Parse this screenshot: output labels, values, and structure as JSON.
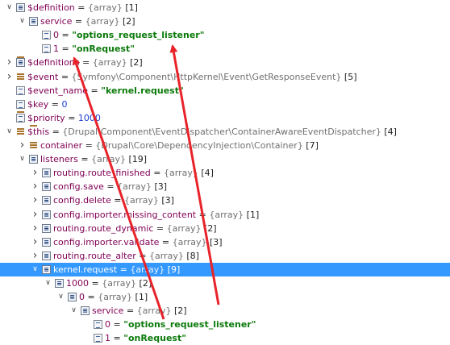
{
  "tree": [
    {
      "depth": 0,
      "expand": "open",
      "icon": "array",
      "name": "$definition",
      "eq": " = ",
      "type": "{array}",
      "suffix": " [1]"
    },
    {
      "depth": 1,
      "expand": "open",
      "icon": "array",
      "name": "service",
      "eq": " = ",
      "type": "{array}",
      "suffix": " [2]"
    },
    {
      "depth": 2,
      "expand": "none",
      "icon": "leaf",
      "name": "0",
      "eq": " = ",
      "value": "\"options_request_listener\"",
      "valueKind": "string"
    },
    {
      "depth": 2,
      "expand": "none",
      "icon": "leaf",
      "name": "1",
      "eq": " = ",
      "value": "\"onRequest\"",
      "valueKind": "string"
    },
    {
      "depth": 0,
      "expand": "closed",
      "icon": "array",
      "name": "$definitions",
      "eq": " = ",
      "type": "{array}",
      "suffix": " [2]"
    },
    {
      "depth": 0,
      "expand": "closed",
      "icon": "object",
      "name": "$event",
      "eq": " = ",
      "type": "{Symfony\\Component\\HttpKernel\\Event\\GetResponseEvent}",
      "suffix": " [5]"
    },
    {
      "depth": 0,
      "expand": "none",
      "icon": "leaf",
      "name": "$event_name",
      "eq": " = ",
      "value": "\"kernel.request\"",
      "valueKind": "string"
    },
    {
      "depth": 0,
      "expand": "none",
      "icon": "leaf",
      "name": "$key",
      "eq": " = ",
      "value": "0",
      "valueKind": "number"
    },
    {
      "depth": 0,
      "expand": "none",
      "icon": "leaf",
      "name": "$priority",
      "eq": " = ",
      "value": "1000",
      "valueKind": "number"
    },
    {
      "depth": 0,
      "expand": "open",
      "icon": "object",
      "name": "$this",
      "eq": " = ",
      "type": "{Drupal\\Component\\EventDispatcher\\ContainerAwareEventDispatcher}",
      "suffix": " [4]"
    },
    {
      "depth": 1,
      "expand": "closed",
      "icon": "object",
      "name": "container",
      "eq": " = ",
      "type": "{Drupal\\Core\\DependencyInjection\\Container}",
      "suffix": " [7]"
    },
    {
      "depth": 1,
      "expand": "open",
      "icon": "array",
      "name": "listeners",
      "eq": " = ",
      "type": "{array}",
      "suffix": " [19]"
    },
    {
      "depth": 2,
      "expand": "closed",
      "icon": "array",
      "name": "routing.route_finished",
      "eq": " = ",
      "type": "{array}",
      "suffix": " [4]"
    },
    {
      "depth": 2,
      "expand": "closed",
      "icon": "array",
      "name": "config.save",
      "eq": " = ",
      "type": "{array}",
      "suffix": " [3]"
    },
    {
      "depth": 2,
      "expand": "closed",
      "icon": "array",
      "name": "config.delete",
      "eq": " = ",
      "type": "{array}",
      "suffix": " [3]"
    },
    {
      "depth": 2,
      "expand": "closed",
      "icon": "array",
      "name": "config.importer.missing_content",
      "eq": " = ",
      "type": "{array}",
      "suffix": " [1]"
    },
    {
      "depth": 2,
      "expand": "closed",
      "icon": "array",
      "name": "routing.route_dynamic",
      "eq": " = ",
      "type": "{array}",
      "suffix": " [2]"
    },
    {
      "depth": 2,
      "expand": "closed",
      "icon": "array",
      "name": "config.importer.validate",
      "eq": " = ",
      "type": "{array}",
      "suffix": " [3]"
    },
    {
      "depth": 2,
      "expand": "closed",
      "icon": "array",
      "name": "routing.route_alter",
      "eq": " = ",
      "type": "{array}",
      "suffix": " [8]"
    },
    {
      "depth": 2,
      "expand": "open",
      "icon": "array",
      "name": "kernel.request",
      "eq": " = ",
      "type": "{array}",
      "suffix": " [9]",
      "selected": true
    },
    {
      "depth": 3,
      "expand": "open",
      "icon": "array",
      "name": "1000",
      "eq": " = ",
      "type": "{array}",
      "suffix": " [2]"
    },
    {
      "depth": 4,
      "expand": "open",
      "icon": "array",
      "name": "0",
      "eq": " = ",
      "type": "{array}",
      "suffix": " [1]"
    },
    {
      "depth": 5,
      "expand": "open",
      "icon": "array",
      "name": "service",
      "eq": " = ",
      "type": "{array}",
      "suffix": " [2]"
    },
    {
      "depth": 6,
      "expand": "none",
      "icon": "leaf",
      "name": "0",
      "eq": " = ",
      "value": "\"options_request_listener\"",
      "valueKind": "string"
    },
    {
      "depth": 6,
      "expand": "none",
      "icon": "leaf",
      "name": "1",
      "eq": " = ",
      "value": "\"onRequest\"",
      "valueKind": "string"
    }
  ],
  "colors": {
    "annotation_arrow": "#e8232a",
    "selection": "#3399ff",
    "string_value": "#0b7a0b",
    "variable_name": "#7f0055"
  }
}
